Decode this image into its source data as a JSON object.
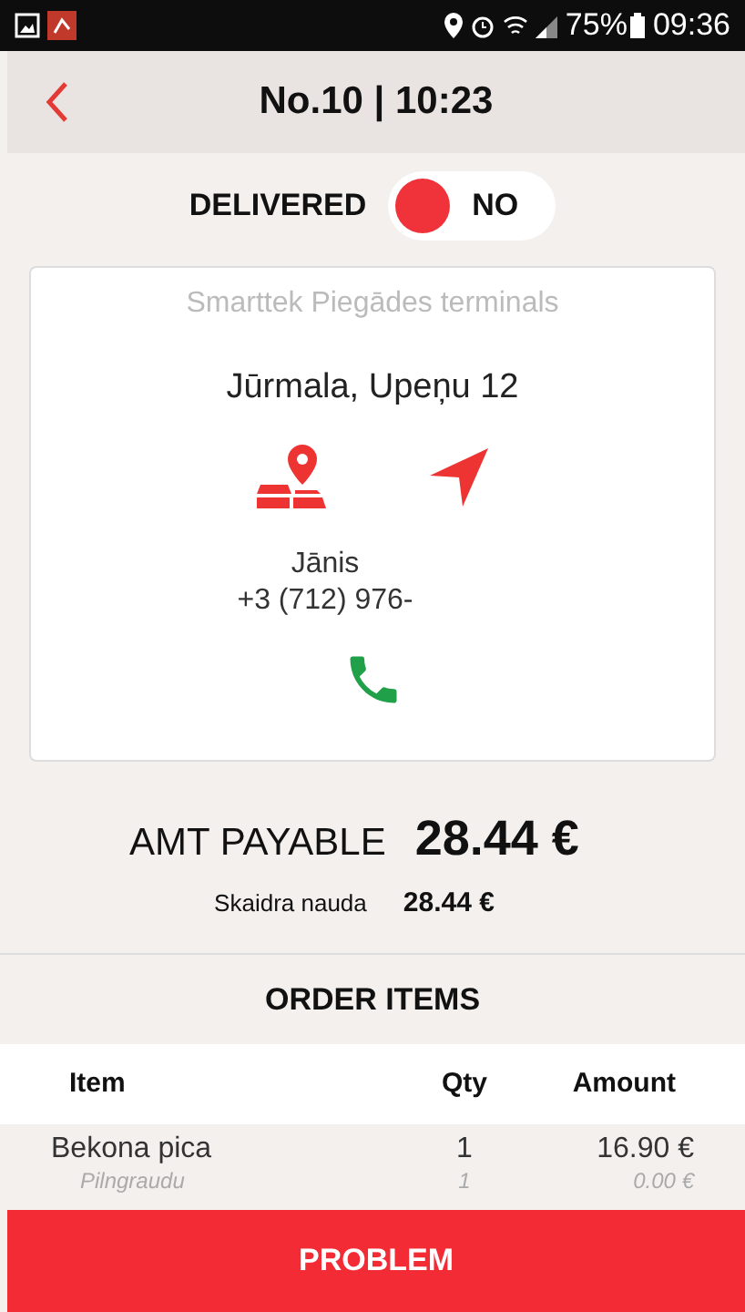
{
  "status_bar": {
    "battery": "75%",
    "time": "09:36"
  },
  "header": {
    "title": "No.10 | 10:23"
  },
  "delivered": {
    "label": "DELIVERED",
    "value": "NO",
    "on": false
  },
  "address_card": {
    "terminal": "Smarttek Piegādes terminals",
    "address": "Jūrmala, Upeņu 12",
    "contact_name": "Jānis",
    "phone": "+3 (712) 976-"
  },
  "payment": {
    "label": "AMT PAYABLE",
    "total": "28.44 €",
    "method": "Skaidra nauda",
    "method_amount": "28.44 €"
  },
  "order_items": {
    "title": "ORDER ITEMS",
    "columns": [
      "Item",
      "Qty",
      "Amount"
    ],
    "rows": [
      {
        "kind": "item",
        "cells": [
          "Bekona pica",
          "1",
          "16.90 €"
        ]
      },
      {
        "kind": "option",
        "cells": [
          "Pilngraudu",
          "1",
          "0.00 €"
        ]
      }
    ]
  },
  "problem_button": {
    "label": "PROBLEM"
  }
}
